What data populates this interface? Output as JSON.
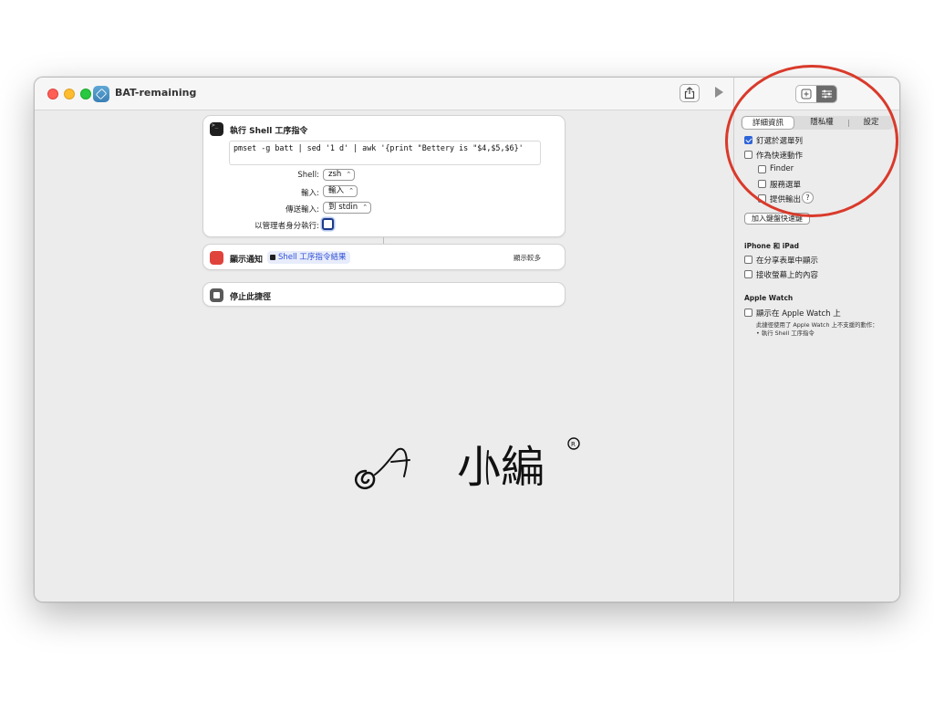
{
  "window": {
    "title": "BAT-remaining"
  },
  "toolbar": {
    "share_icon": "share-icon",
    "run_icon": "play-icon"
  },
  "actions": {
    "shell": {
      "title": "執行 Shell 工序指令",
      "script": "pmset -g batt | sed '1 d' | awk '{print \"Bettery is \"$4,$5,$6}'",
      "shell_label": "Shell:",
      "shell_value": "zsh",
      "input_label": "輸入:",
      "input_value": "輸入",
      "pass_label": "傳送輸入:",
      "pass_value": "到 stdin",
      "admin_label": "以管理者身分執行:"
    },
    "notify": {
      "title": "顯示通知",
      "variable": "Shell 工序指令結果",
      "show_more": "顯示較多"
    },
    "stop": {
      "title": "停止此捷徑"
    }
  },
  "watermark": {
    "text": "小編"
  },
  "sidebar": {
    "tabs": [
      "詳細資訊",
      "隱私權",
      "設定"
    ],
    "options": [
      {
        "label": "釘選於選單列",
        "checked": true
      },
      {
        "label": "作為快速動作",
        "checked": false
      },
      {
        "label": "Finder",
        "checked": false
      },
      {
        "label": "服務選單",
        "checked": false
      },
      {
        "label": "提供輸出",
        "checked": false
      }
    ],
    "help": "?",
    "keyboard_button": "加入鍵盤快速鍵",
    "iphone_section": "iPhone 和 iPad",
    "iphone_options": [
      {
        "label": "在分享表單中顯示",
        "checked": false
      },
      {
        "label": "接收螢幕上的內容",
        "checked": false
      }
    ],
    "watch_section": "Apple Watch",
    "watch_option": {
      "label": "顯示在 Apple Watch 上",
      "checked": false
    },
    "watch_note_1": "此捷徑使用了 Apple Watch 上不支援的動作：",
    "watch_note_2": "• 執行 Shell 工序指令"
  },
  "colors": {
    "accent": "#2f65d8",
    "annotation_ring": "#d93a2b",
    "notify": "#e0433b"
  }
}
